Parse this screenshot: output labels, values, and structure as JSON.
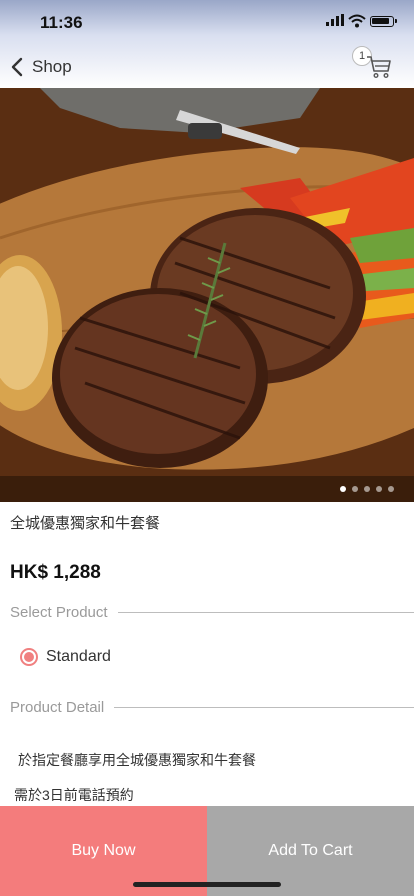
{
  "status_bar": {
    "time": "11:36"
  },
  "nav": {
    "back_label": "Shop",
    "cart_count": "1"
  },
  "gallery": {
    "total": 5,
    "active_index": 0
  },
  "product": {
    "title": "全城優惠獨家和牛套餐",
    "price": "HK$ 1,288"
  },
  "select_section": {
    "label": "Select Product"
  },
  "options": [
    {
      "label": "Standard",
      "selected": true
    }
  ],
  "detail_section": {
    "label": "Product Detail"
  },
  "details": [
    "於指定餐廳享用全城優惠獨家和牛套餐",
    "需於3日前電話預約"
  ],
  "actions": {
    "buy_label": "Buy Now",
    "cart_label": "Add To Cart"
  },
  "colors": {
    "accent": "#f47c7c",
    "secondary": "#a8a8a8"
  }
}
